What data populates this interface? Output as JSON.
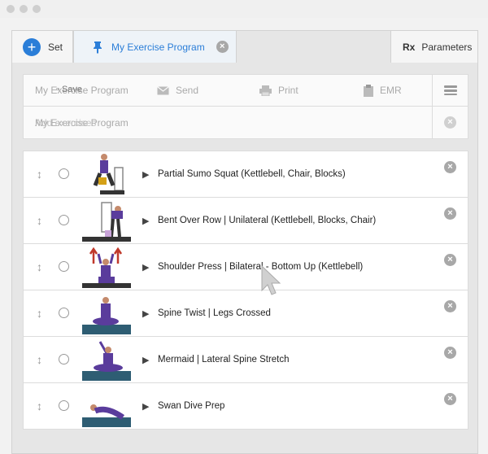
{
  "tabs": {
    "set_label": "Set",
    "program_label": "My Exercise Program",
    "parameters_label": "Parameters",
    "rx_glyph": "Rx"
  },
  "toolbar": {
    "name_overlap": "My Exercise Program",
    "save_overlap": "Save",
    "send": "Send",
    "print": "Print",
    "emr": "EMR"
  },
  "name_field": {
    "value": "My Exercise Program",
    "ghost": "Add exercises"
  },
  "exercises": [
    {
      "title": "Partial Sumo Squat (Kettlebell, Chair, Blocks)"
    },
    {
      "title": "Bent Over Row | Unilateral (Kettlebell, Blocks, Chair)"
    },
    {
      "title": "Shoulder Press | Bilateral - Bottom Up (Kettlebell)"
    },
    {
      "title": "Spine Twist | Legs Crossed"
    },
    {
      "title": "Mermaid | Lateral Spine Stretch"
    },
    {
      "title": "Swan Dive Prep"
    }
  ],
  "colors": {
    "accent": "#2b7ed8",
    "frame": "#e6e6e6",
    "shirt": "#5a3c9c",
    "mat": "#2e5d73"
  },
  "icons": {
    "window_dots": "window-dot",
    "pin": "pin-icon",
    "send": "envelope-icon",
    "print": "printer-icon",
    "emr": "clipboard-icon",
    "settings": "sliders-icon",
    "handle": "drag-handle-icon",
    "video": "video-icon",
    "remove": "close-icon"
  }
}
